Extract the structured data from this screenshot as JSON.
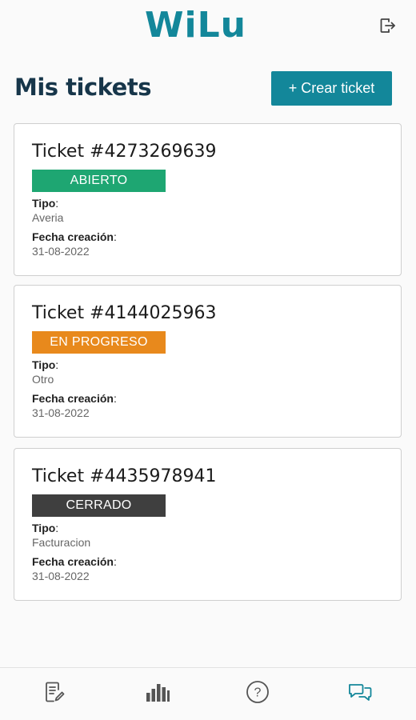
{
  "header": {
    "logo_text": "WiLu",
    "logout_icon": "logout-icon"
  },
  "page": {
    "title": "Mis tickets",
    "create_button_label": "+ Crear ticket"
  },
  "labels": {
    "tipo": "Tipo",
    "fecha": "Fecha creación",
    "colon": ":"
  },
  "tickets": [
    {
      "id_text": "Ticket #4273269639",
      "status": "ABIERTO",
      "status_color": "#1ea672",
      "tipo": "Averia",
      "fecha": "31-08-2022"
    },
    {
      "id_text": "Ticket #4144025963",
      "status": "EN PROGRESO",
      "status_color": "#e8891c",
      "tipo": "Otro",
      "fecha": "31-08-2022"
    },
    {
      "id_text": "Ticket #4435978941",
      "status": "CERRADO",
      "status_color": "#3f3f3f",
      "tipo": "Facturacion",
      "fecha": "31-08-2022"
    }
  ],
  "bottom_nav": {
    "items": [
      "tickets-edit-icon",
      "stats-bar-icon",
      "help-question-icon",
      "chat-icon"
    ]
  },
  "colors": {
    "brand": "#13879a",
    "title": "#17364a"
  }
}
